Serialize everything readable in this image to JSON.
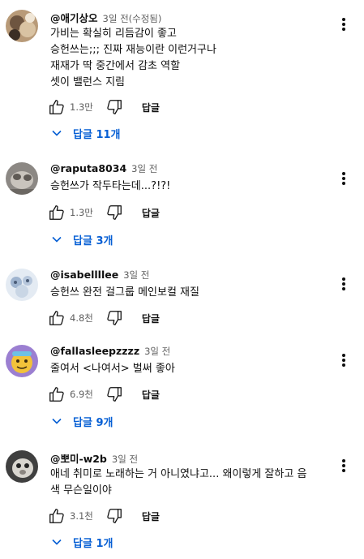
{
  "comments": [
    {
      "author": "@애기상오",
      "time": "3일 전(수정됨)",
      "lines": [
        "가비는 확실히 리듬감이 좋고",
        "승헌쓰는;;; 진짜 재능이란 이런거구나",
        "재재가 딱 중간에서 감초 역할",
        "셋이 밸런스 지림"
      ],
      "likes": "1.3만",
      "reply_label": "답글",
      "replies_label": "답글 11개"
    },
    {
      "author": "@raputa8034",
      "time": "3일 전",
      "lines": [
        "승헌쓰가 작두타는데...?!?!"
      ],
      "likes": "1.3만",
      "reply_label": "답글",
      "replies_label": "답글 3개"
    },
    {
      "author": "@isabellllee",
      "time": "3일 전",
      "lines": [
        "승헌쓰 완전 걸그룹 메인보컬 재질"
      ],
      "likes": "4.8천",
      "reply_label": "답글"
    },
    {
      "author": "@fallasleepzzzz",
      "time": "3일 전",
      "lines": [
        "줄여서 <나여서> 벌써 좋아"
      ],
      "likes": "6.9천",
      "reply_label": "답글",
      "replies_label": "답글 9개"
    },
    {
      "author": "@뽀미-w2b",
      "time": "3일 전",
      "lines": [
        "애네 취미로 노래하는 거 아니였냐고... 왜이렇게 잘하고 음",
        "색 무슨일이야"
      ],
      "likes": "3.1천",
      "reply_label": "답글",
      "replies_label": "답글 1개"
    }
  ],
  "colors": {
    "link": "#065fd4",
    "secondary": "#606060",
    "text": "#0f0f0f"
  }
}
